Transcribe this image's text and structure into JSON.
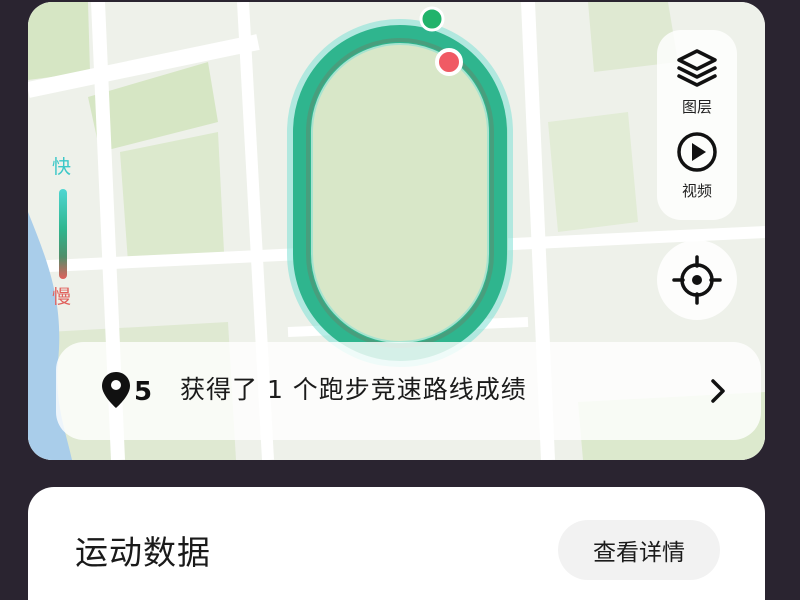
{
  "map": {
    "speed_legend": {
      "fast_label": "快",
      "slow_label": "慢",
      "fast_color": "#4fd6d2",
      "slow_color": "#e0605c"
    },
    "tools": {
      "layers_label": "图层",
      "video_label": "视频",
      "layers_icon": "layers-icon",
      "video_icon": "play-circle-icon",
      "locate_icon": "crosshair-icon"
    },
    "route": {
      "start_color": "#21b36b",
      "end_color": "#f05a64",
      "track_color": "#2fb58e"
    },
    "banner": {
      "icon_text": "5",
      "text": "获得了 1 个跑步竞速路线成绩",
      "arrow_icon": "chevron-right-icon"
    }
  },
  "workout_data": {
    "title": "运动数据",
    "detail_button": "查看详情"
  }
}
